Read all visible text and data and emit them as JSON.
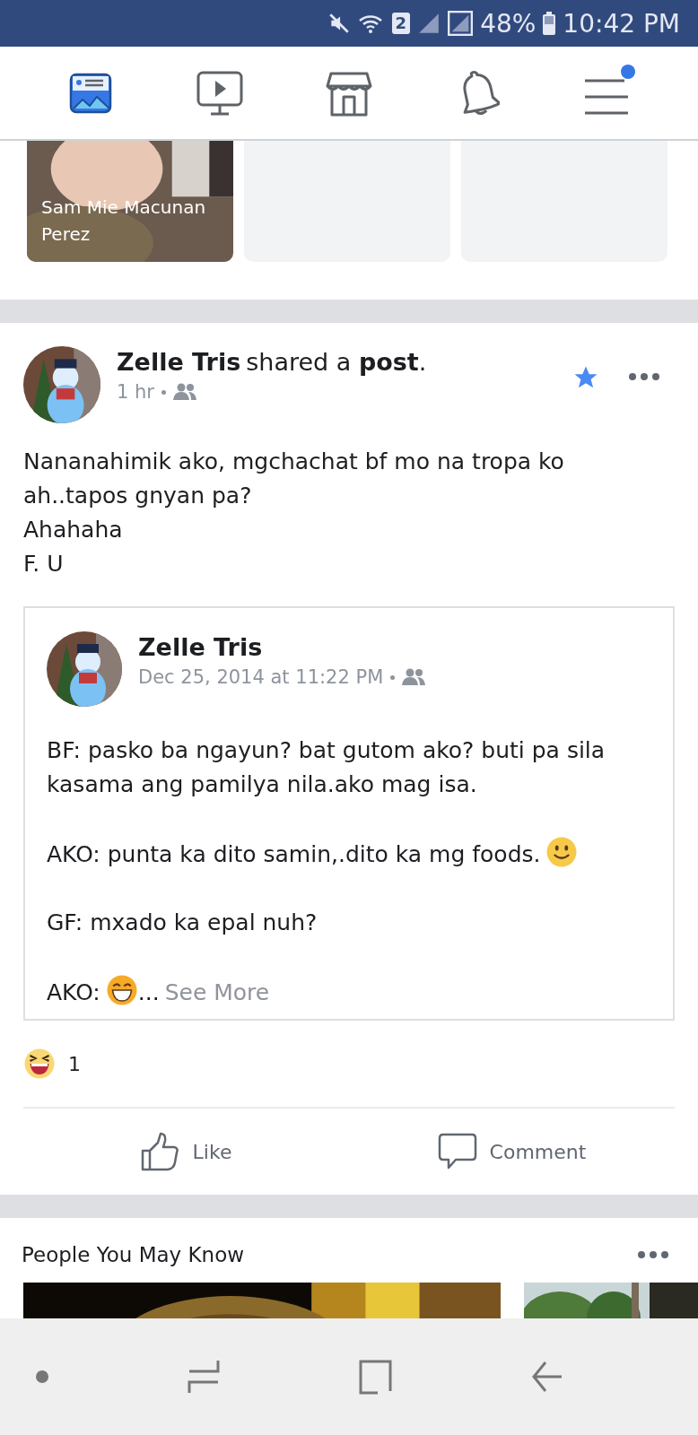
{
  "status_bar": {
    "sim": "2",
    "battery": "48%",
    "time": "10:42 PM"
  },
  "nav": {
    "tabs": [
      {
        "kind": "news",
        "selected": true,
        "badge": false
      },
      {
        "kind": "video",
        "selected": false,
        "badge": false
      },
      {
        "kind": "shop",
        "selected": false,
        "badge": false
      },
      {
        "kind": "bell",
        "selected": false,
        "badge": false
      },
      {
        "kind": "menu",
        "selected": false,
        "badge": true
      }
    ]
  },
  "stories": [
    {
      "name": "Sam Mie Macunan Perez",
      "kind": "picture"
    },
    {
      "kind": "empty"
    },
    {
      "kind": "empty"
    }
  ],
  "post": {
    "author": "Zelle Tris",
    "action": "shared a **post**.",
    "time": "1 hr",
    "starred": true,
    "text": [
      "Nananahimik ako, mgchachat bf mo na tropa ko ah..tapos gnyan pa?",
      "Ahahaha",
      "F. U"
    ],
    "shared": {
      "author": "Zelle Tris",
      "time": "Dec 25, 2014 at 11:22 PM",
      "lines": [
        {
          "kind": "plain",
          "text": "BF: pasko ba ngayun? bat gutom ako? buti pa sila kasama ang pamilya nila.ako mag isa."
        },
        {
          "kind": "smile",
          "text": "AKO: punta ka dito samin,.dito ka mg foods."
        },
        {
          "kind": "plain",
          "text": "GF: mxado ka epal nuh?"
        },
        {
          "kind": "grin",
          "text": "AKO:",
          "after": "...",
          "link": "See More"
        }
      ]
    },
    "reaction_count": "1",
    "actions": [
      {
        "kind": "like",
        "label": "Like"
      },
      {
        "kind": "comment",
        "label": "Comment"
      }
    ]
  },
  "people_you_may_know": {
    "title": "People You May Know"
  }
}
